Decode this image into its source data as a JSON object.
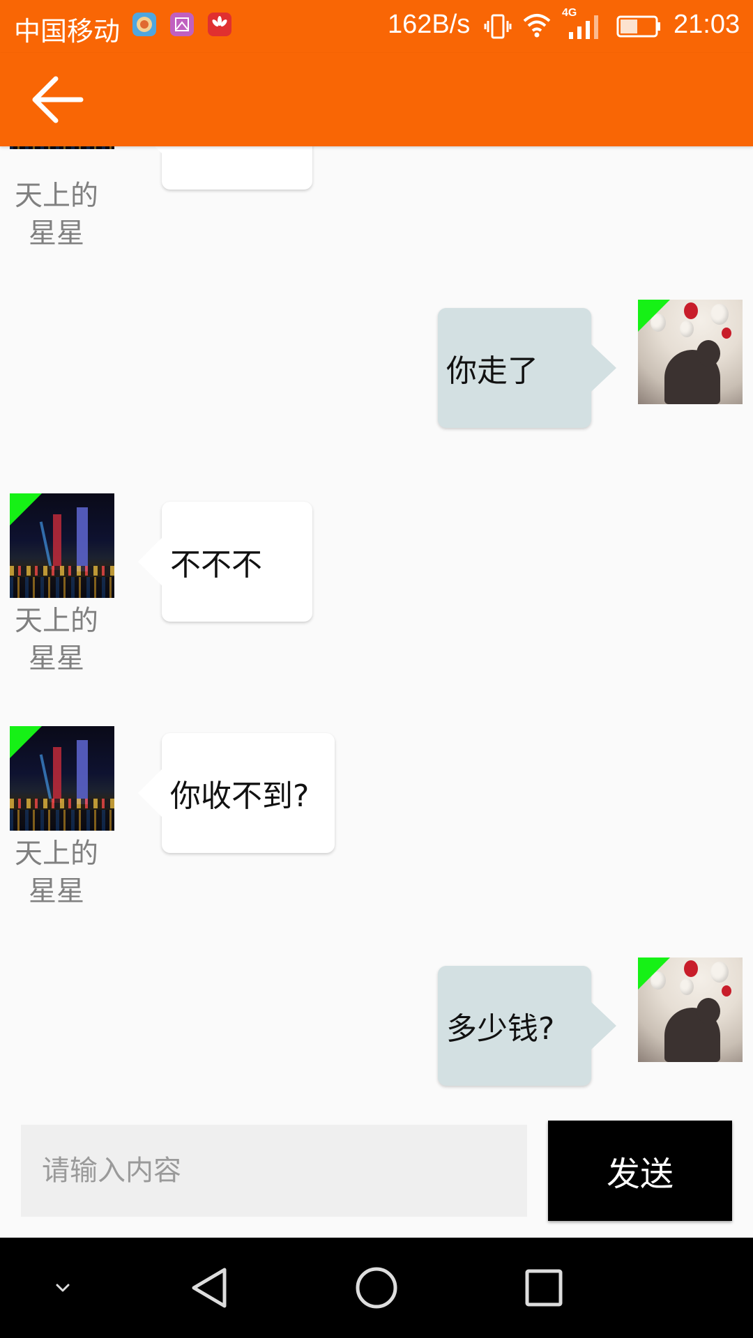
{
  "status_bar": {
    "carrier": "中国移动",
    "net_speed": "162B/s",
    "network_type": "4G",
    "time": "21:03",
    "icons": [
      "app-notify-icon",
      "gallery-icon",
      "huawei-icon",
      "vibrate-icon",
      "wifi-icon",
      "cell-signal-icon",
      "battery-icon"
    ],
    "battery_level": 0.45
  },
  "app_bar": {
    "back_icon": "arrow-left-icon",
    "color": "#f96605"
  },
  "messages": [
    {
      "side": "left",
      "nickname": "天上的\n星星",
      "text": ""
    },
    {
      "side": "right",
      "text": "你走了"
    },
    {
      "side": "left",
      "nickname": "天上的\n星星",
      "text": "不不不"
    },
    {
      "side": "left",
      "nickname": "天上的\n星星",
      "text": "你收不到?"
    },
    {
      "side": "right",
      "text": "多少钱?"
    }
  ],
  "composer": {
    "placeholder": "请输入内容",
    "value": "",
    "send_label": "发送"
  },
  "nav_bar": {
    "icons": [
      "hide-keyboard-icon",
      "back-triangle-icon",
      "home-circle-icon",
      "recents-square-icon"
    ]
  },
  "colors": {
    "accent": "#f96605",
    "incoming_bubble": "#ffffff",
    "outgoing_bubble": "#d3e0e2",
    "unread_corner": "#16f116"
  }
}
